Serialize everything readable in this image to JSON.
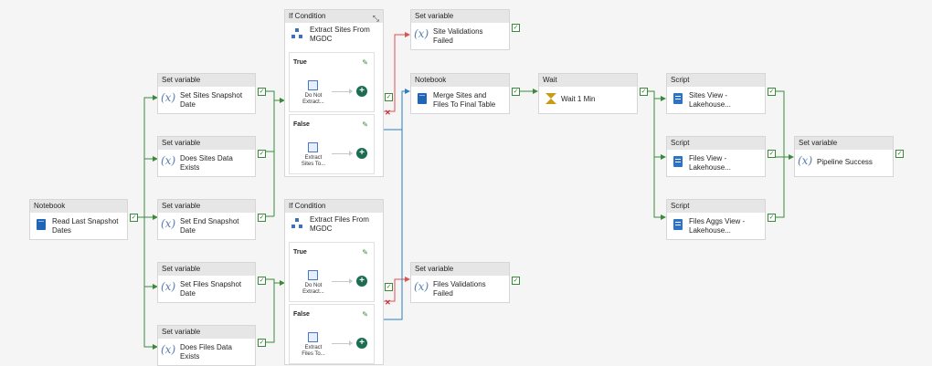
{
  "nodes": {
    "read_dates": {
      "type": "Notebook",
      "label": [
        "Read Last Snapshot",
        "Dates"
      ]
    },
    "set_sites_snapshot": {
      "type": "Set variable",
      "label": [
        "Set Sites Snapshot",
        "Date"
      ]
    },
    "sites_exists": {
      "type": "Set variable",
      "label": [
        "Does Sites Data",
        "Exists"
      ]
    },
    "set_end_snapshot": {
      "type": "Set variable",
      "label": [
        "Set End Snapshot",
        "Date"
      ]
    },
    "set_files_snapshot": {
      "type": "Set variable",
      "label": [
        "Set Files Snapshot",
        "Date"
      ]
    },
    "files_exists": {
      "type": "Set variable",
      "label": [
        "Does Files Data",
        "Exists"
      ]
    },
    "site_validations": {
      "type": "Set variable",
      "label": [
        "Site Validations",
        "Failed"
      ]
    },
    "files_validations": {
      "type": "Set variable",
      "label": [
        "Files Validations",
        "Failed"
      ]
    },
    "merge": {
      "type": "Notebook",
      "label": [
        "Merge Sites and",
        "Files To Final Table"
      ]
    },
    "wait": {
      "type": "Wait",
      "label": [
        "Wait 1 Min"
      ]
    },
    "sites_view": {
      "type": "Script",
      "label": [
        "Sites View -",
        "Lakehouse..."
      ]
    },
    "files_view": {
      "type": "Script",
      "label": [
        "Files View -",
        "Lakehouse..."
      ]
    },
    "files_aggs": {
      "type": "Script",
      "label": [
        "Files Aggs View -",
        "Lakehouse..."
      ]
    },
    "pipeline_success": {
      "type": "Set variable",
      "label": [
        "Pipeline Success"
      ]
    }
  },
  "if_conditions": [
    {
      "type": "If Condition",
      "title": [
        "Extract Sites From",
        "MGDC"
      ],
      "true_branch": {
        "name": "True",
        "activity": [
          "Do Not",
          "Extract..."
        ]
      },
      "false_branch": {
        "name": "False",
        "activity": [
          "Extract",
          "Sites To..."
        ]
      }
    },
    {
      "type": "If Condition",
      "title": [
        "Extract Files From",
        "MGDC"
      ],
      "true_branch": {
        "name": "True",
        "activity": [
          "Do Not",
          "Extract..."
        ]
      },
      "false_branch": {
        "name": "False",
        "activity": [
          "Extract",
          "Files To..."
        ]
      }
    }
  ],
  "symbols": {
    "check": "✓",
    "fail": "✕",
    "add": "+",
    "edit": "✎",
    "collapse": "⤡",
    "variable": "(x)"
  },
  "colors": {
    "success_link": "#3b8a3b",
    "fail_link": "#d9534f",
    "completion_link": "#2a7fbf"
  }
}
